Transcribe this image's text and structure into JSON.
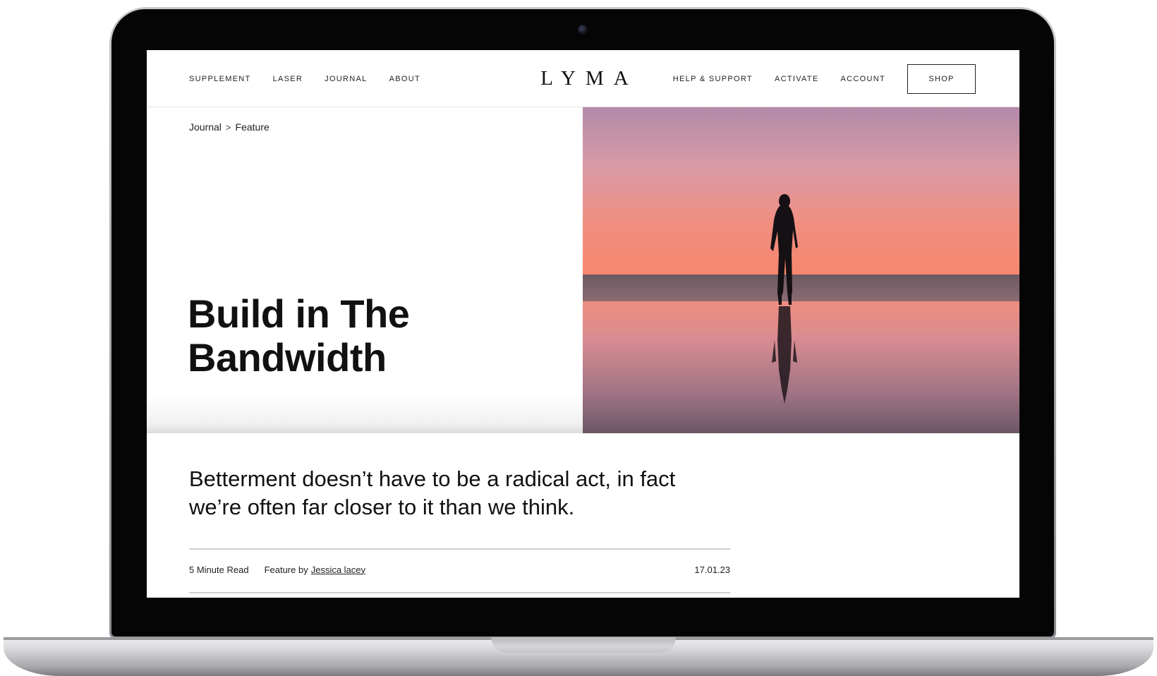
{
  "nav": {
    "left_links": [
      "SUPPLEMENT",
      "LASER",
      "JOURNAL",
      "ABOUT"
    ],
    "logo": "LYMA",
    "right_links": [
      "HELP & SUPPORT",
      "ACTIVATE",
      "ACCOUNT"
    ],
    "shop_label": "SHOP"
  },
  "breadcrumb": {
    "parent": "Journal",
    "separator": ">",
    "current": "Feature"
  },
  "hero": {
    "title_line1": "Build in The",
    "title_line2": "Bandwidth"
  },
  "article": {
    "lede": "Betterment doesn’t have to be a radical act, in fact we’re often far closer to it than we think.",
    "read_time": "5 Minute Read",
    "byline_prefix": "Feature by",
    "author": "Jessica lacey",
    "date": "17.01.23"
  }
}
